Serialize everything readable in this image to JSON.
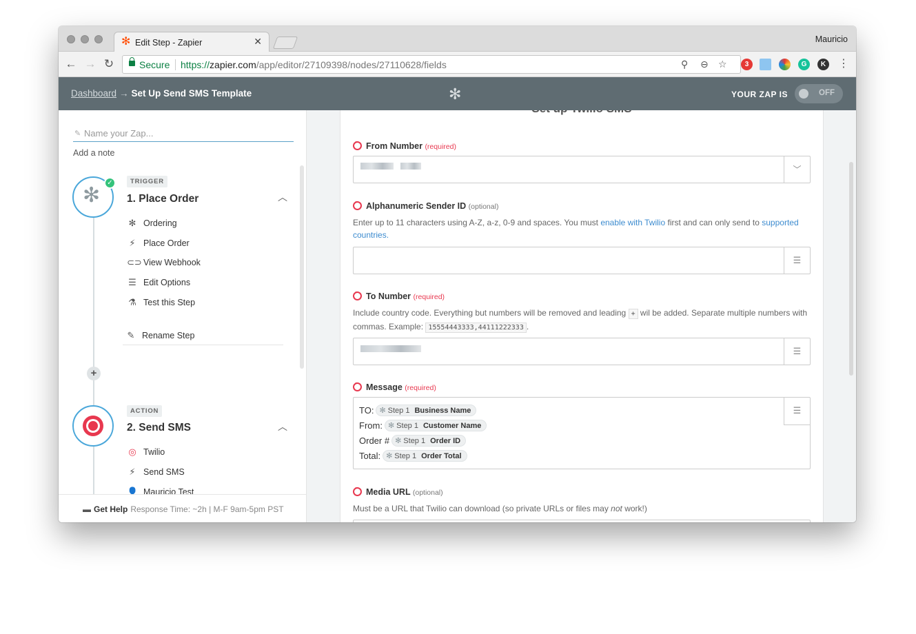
{
  "browser": {
    "tab_title": "Edit Step - Zapier",
    "profile_name": "Mauricio",
    "secure_label": "Secure",
    "url_scheme": "https://",
    "url_host": "zapier.com",
    "url_path": "/app/editor/27109398/nodes/27110628/fields",
    "extension_badge": "3"
  },
  "header": {
    "dashboard_link": "Dashboard",
    "arrow": "→",
    "page_title": "Set Up Send SMS Template",
    "zap_status_label": "YOUR ZAP IS",
    "toggle_label": "OFF"
  },
  "sidebar": {
    "zap_name_placeholder": "Name your Zap...",
    "add_note": "Add a note",
    "trigger": {
      "badge": "TRIGGER",
      "title": "1. Place Order",
      "items": [
        {
          "icon": "gear-icon",
          "label": "Ordering"
        },
        {
          "icon": "lightning-icon",
          "label": "Place Order"
        },
        {
          "icon": "link-icon",
          "label": "View Webhook"
        },
        {
          "icon": "list-icon",
          "label": "Edit Options"
        },
        {
          "icon": "flask-icon",
          "label": "Test this Step"
        }
      ],
      "rename": "Rename Step"
    },
    "action": {
      "badge": "ACTION",
      "title": "2. Send SMS",
      "items": [
        {
          "icon": "twilio-icon",
          "label": "Twilio"
        },
        {
          "icon": "lightning-icon",
          "label": "Send SMS"
        },
        {
          "icon": "user-icon",
          "label": "Mauricio Test"
        }
      ]
    },
    "help": {
      "label": "Get Help",
      "info": "Response Time: ~2h | M-F 9am-5pm PST"
    }
  },
  "form": {
    "heading": "Set up Twilio SMS",
    "from_number": {
      "label": "From Number",
      "tag": "(required)"
    },
    "sender_id": {
      "label": "Alphanumeric Sender ID",
      "tag": "(optional)",
      "help_1": "Enter up to 11 characters using A-Z, a-z, 0-9 and spaces. You must ",
      "link_1": "enable with Twilio",
      "help_2": " first and can only send to ",
      "link_2": "supported countries."
    },
    "to_number": {
      "label": "To Number",
      "tag": "(required)",
      "help_1": "Include country code. Everything but numbers will be removed and leading ",
      "plus_code": "+",
      "help_2": " wil be added. Separate multiple numbers with commas. Example: ",
      "example_code": "15554443333,44111222333",
      "help_3": "."
    },
    "message": {
      "label": "Message",
      "tag": "(required)",
      "lines": [
        {
          "prefix": "TO:",
          "step": "Step 1",
          "field": "Business Name"
        },
        {
          "prefix": "From:",
          "step": "Step 1",
          "field": "Customer Name"
        },
        {
          "prefix": "Order #",
          "step": "Step 1",
          "field": "Order ID"
        },
        {
          "prefix": "Total:",
          "step": "Step 1",
          "field": "Order Total"
        }
      ]
    },
    "media_url": {
      "label": "Media URL",
      "tag": "(optional)",
      "help_1": "Must be a URL that Twilio can download (so private URLs or files may ",
      "help_em": "not",
      "help_2": " work!)"
    }
  },
  "colors": {
    "header_bg": "#5f6c72",
    "accent_blue": "#4aa7da",
    "twilio_red": "#e8384f",
    "success_green": "#34c37b",
    "zapier_orange": "#ff4a00"
  }
}
